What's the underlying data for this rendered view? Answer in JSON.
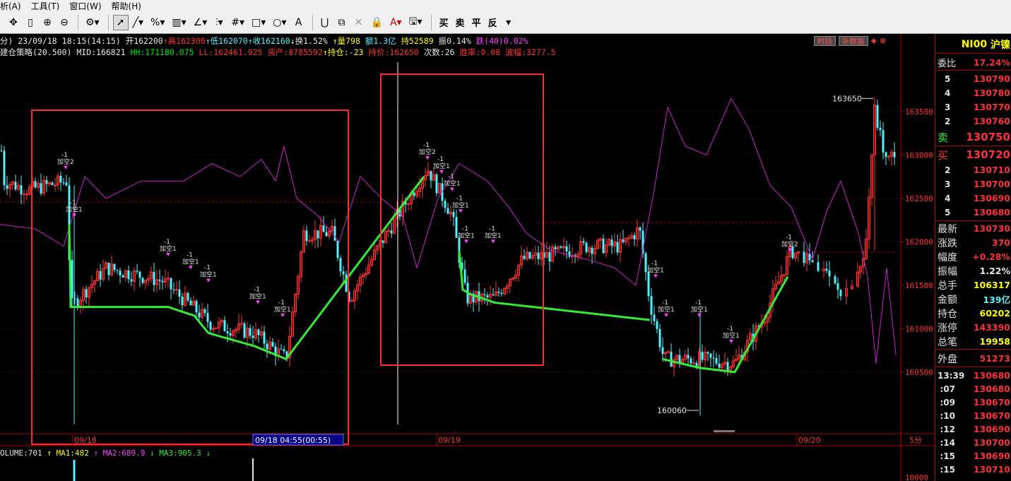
{
  "menu": [
    "析(A)",
    "工具(T)",
    "窗口(W)",
    "帮助(H)"
  ],
  "toolbar_text": [
    "买",
    "卖",
    "平",
    "反"
  ],
  "info1": {
    "period": "分) 23/09/18 18:15(14:15)",
    "open_label": "开",
    "open": "162200",
    "high_label": "高",
    "high": "162300",
    "low_label": "低",
    "low": "162070",
    "close_label": "收",
    "close": "162160",
    "turnover": "换1.52%",
    "volume": "量798",
    "amount": "额1.3亿",
    "position": "持52589",
    "amplitude": "振0.14%",
    "change": "跌(40)0.02%"
  },
  "info2": {
    "strategy": "建仓策略(20.500)",
    "mid": "MID:166821",
    "hh": "HH:171180.075",
    "ll": "LL:162461.925",
    "asset": "资产:8785592",
    "hold": "持仓:-23",
    "hold_price": "持价:162650",
    "times": "次数:26",
    "winrate": "胜率:0.08",
    "wave": "波幅:3277.5"
  },
  "top_buttons": [
    "时段",
    "补数据"
  ],
  "volume_bar": {
    "label": "OLUME:701",
    "ma1": "MA1:482",
    "ma2": "MA2:689.9",
    "ma3": "MA3:905.3"
  },
  "chart_data": {
    "type": "candlestick",
    "y_ticks": [
      163500,
      163000,
      162500,
      162000,
      161500,
      161000,
      160500
    ],
    "ylim": [
      159800,
      164100
    ],
    "x_labels": [
      "09/18",
      "09/18 04:55(00:55)",
      "09/19",
      "09/20"
    ],
    "period_label": "5分",
    "annotations": {
      "max": "163650",
      "min": "160060"
    },
    "signal_labels": [
      "-1",
      "加空2",
      "加空1"
    ],
    "volume_tick": "10000"
  },
  "right_panel": {
    "symbol": "NI00",
    "name": "沪镍",
    "ratio_label": "委比",
    "ratio": "17.24%",
    "asks": [
      {
        "n": "5",
        "p": "130790"
      },
      {
        "n": "4",
        "p": "130780"
      },
      {
        "n": "3",
        "p": "130770"
      },
      {
        "n": "2",
        "p": "130760"
      }
    ],
    "sell_label": "卖",
    "sell": "130750",
    "buy_label": "买",
    "buy": "130720",
    "bids": [
      {
        "n": "2",
        "p": "130710"
      },
      {
        "n": "3",
        "p": "130700"
      },
      {
        "n": "4",
        "p": "130690"
      },
      {
        "n": "5",
        "p": "130680"
      }
    ],
    "stats": [
      {
        "k": "最新",
        "v": "130730",
        "c": "#ff3232"
      },
      {
        "k": "涨跌",
        "v": "370",
        "c": "#ff3232"
      },
      {
        "k": "幅度",
        "v": "+0.28%",
        "c": "#ff3232"
      },
      {
        "k": "振幅",
        "v": "1.22%",
        "c": "#e8e8e8"
      },
      {
        "k": "总手",
        "v": "106317",
        "c": "#ffff00"
      },
      {
        "k": "金额",
        "v": "139亿",
        "c": "#52f2ff"
      },
      {
        "k": "持仓",
        "v": "60202",
        "c": "#ffff00"
      },
      {
        "k": "涨停",
        "v": "143390",
        "c": "#ff3232"
      },
      {
        "k": "总笔",
        "v": "19958",
        "c": "#ffff00"
      }
    ],
    "outer_label": "外盘",
    "outer": "51273",
    "ticks": [
      {
        "t": "13:39",
        "p": "130680"
      },
      {
        "t": ":07",
        "p": "130680"
      },
      {
        "t": ":09",
        "p": "130670"
      },
      {
        "t": ":10",
        "p": "130670"
      },
      {
        "t": ":12",
        "p": "130690"
      },
      {
        "t": ":14",
        "p": "130700"
      },
      {
        "t": ":15",
        "p": "130690"
      },
      {
        "t": ":15",
        "p": "130710"
      }
    ]
  }
}
